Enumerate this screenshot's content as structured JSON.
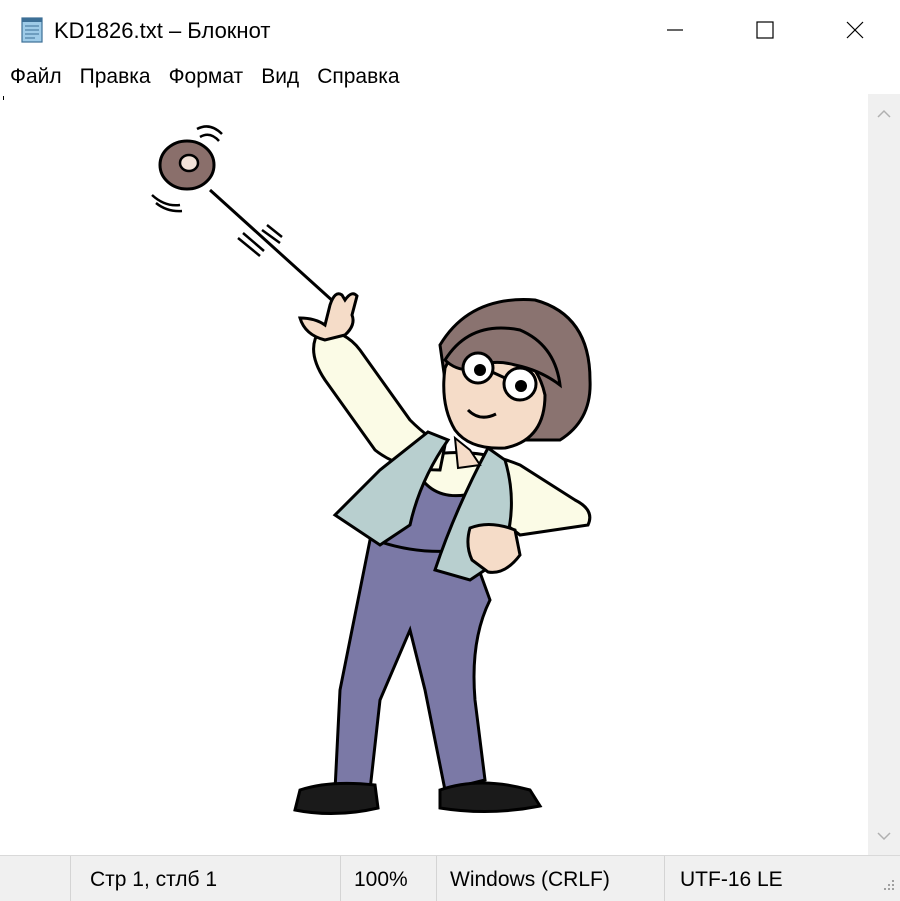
{
  "window": {
    "title": "KD1826.txt – Блокнот",
    "controls": {
      "minimize": "minimize-icon",
      "maximize": "maximize-icon",
      "close": "close-icon"
    }
  },
  "menu": {
    "items": [
      "Файл",
      "Правка",
      "Формат",
      "Вид",
      "Справка"
    ]
  },
  "editor": {
    "content_description_icon": "girl-with-yoyo-illustration"
  },
  "status": {
    "position": "Стр 1, стлб 1",
    "zoom": "100%",
    "line_endings": "Windows (CRLF)",
    "encoding": "UTF-16 LE"
  },
  "colors": {
    "titlebar": "#ffffff",
    "statusbar": "#f0f0f0",
    "hair": "#8a7370",
    "overalls": "#7b79a6",
    "vest": "#b8cfcf",
    "skin": "#f5dcc8",
    "shirt": "#fbfbe6"
  }
}
